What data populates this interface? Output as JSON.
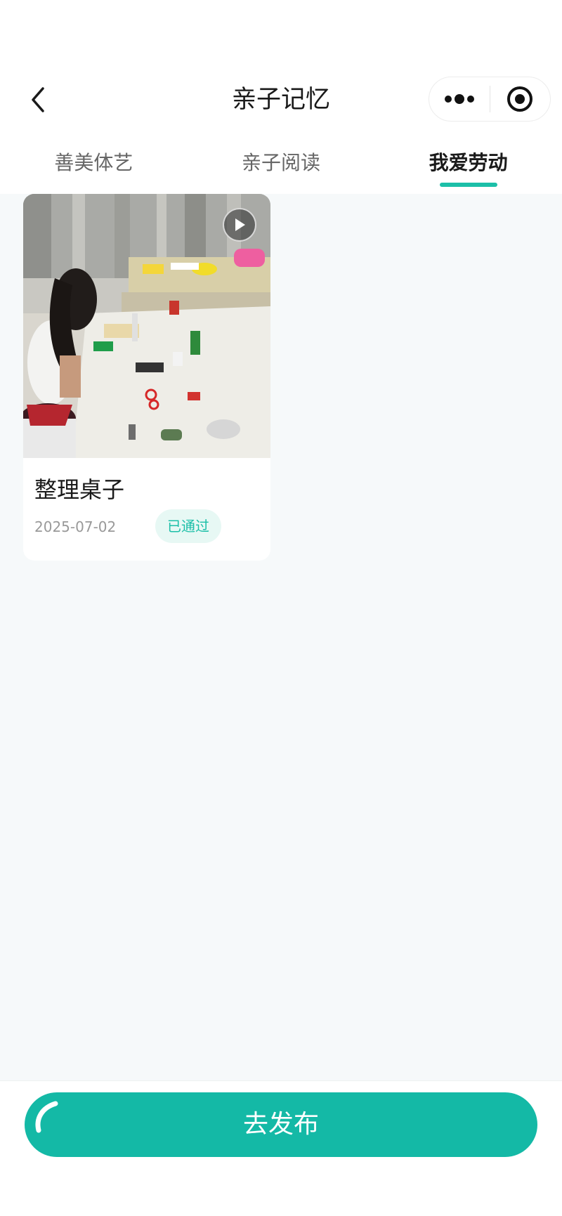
{
  "header": {
    "title": "亲子记忆",
    "back_icon": "chevron-left-icon",
    "more_icon": "more-dots-icon",
    "close_icon": "target-circle-icon"
  },
  "tabs": [
    {
      "label": "善美体艺",
      "active": false
    },
    {
      "label": "亲子阅读",
      "active": false
    },
    {
      "label": "我爱劳动",
      "active": true
    }
  ],
  "cards": [
    {
      "title": "整理桌子",
      "date": "2025-07-02",
      "status": "已通过",
      "media_type": "video",
      "play_icon": "play-icon"
    }
  ],
  "footer": {
    "publish_label": "去发布"
  },
  "colors": {
    "accent": "#1cbfa8",
    "button": "#14b9a6",
    "badge_bg": "#e7f8f4",
    "page_bg": "#f6f9fa"
  }
}
